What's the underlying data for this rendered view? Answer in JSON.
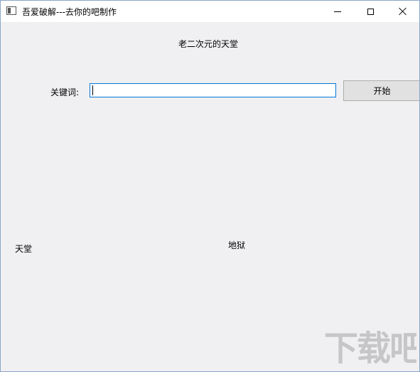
{
  "window": {
    "title": "吾爱破解---去你的吧制作"
  },
  "main": {
    "heading": "老二次元的天堂",
    "keyword_label": "关键词:",
    "keyword_value": "",
    "start_button": "开始",
    "heaven_label": "天堂",
    "hell_label": "地狱"
  },
  "watermark": {
    "text": "下载吧"
  },
  "icons": {
    "app": "app-window-icon",
    "minimize": "minimize-icon",
    "maximize": "maximize-icon",
    "close": "close-icon"
  }
}
